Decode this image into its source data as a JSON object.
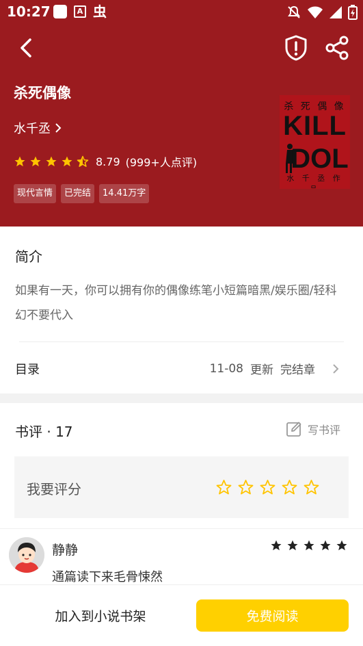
{
  "status_bar": {
    "time": "10:27"
  },
  "colors": {
    "header_bg": "#9b1b1f",
    "star": "#ffc400",
    "read_button": "#ffd000"
  },
  "book": {
    "title": "杀死偶像",
    "author": "水千丞",
    "rating": "8.79",
    "rating_count": "(999+人点评)",
    "tags": [
      "现代言情",
      "已完结",
      "14.41万字"
    ],
    "stars_filled": 4.5,
    "cover": {
      "top_text": "杀 死 偶 像",
      "line1": "KILL",
      "line2": "DOL",
      "bottom_text": "水 千 丞 作 品"
    }
  },
  "intro": {
    "heading": "简介",
    "text": "如果有一天，你可以拥有你的偶像练笔小短篇暗黑/娱乐圈/轻科幻不要代入"
  },
  "toc": {
    "label": "目录",
    "date": "11-08",
    "update": "更新",
    "status": "完结章"
  },
  "reviews": {
    "heading": "书评 · 17",
    "write_label": "写书评",
    "rate_label": "我要评分",
    "items": [
      {
        "name": "静静",
        "stars": 5,
        "text": "通篇读下来毛骨悚然"
      }
    ]
  },
  "bottom": {
    "shelf_label": "加入到小说书架",
    "read_label": "免费阅读"
  },
  "icons": {
    "back": "chevron-left-icon",
    "report": "shield-alert-icon",
    "share": "share-icon",
    "author_more": "chevron-right-icon",
    "toc_more": "chevron-right-icon",
    "write": "edit-icon"
  }
}
